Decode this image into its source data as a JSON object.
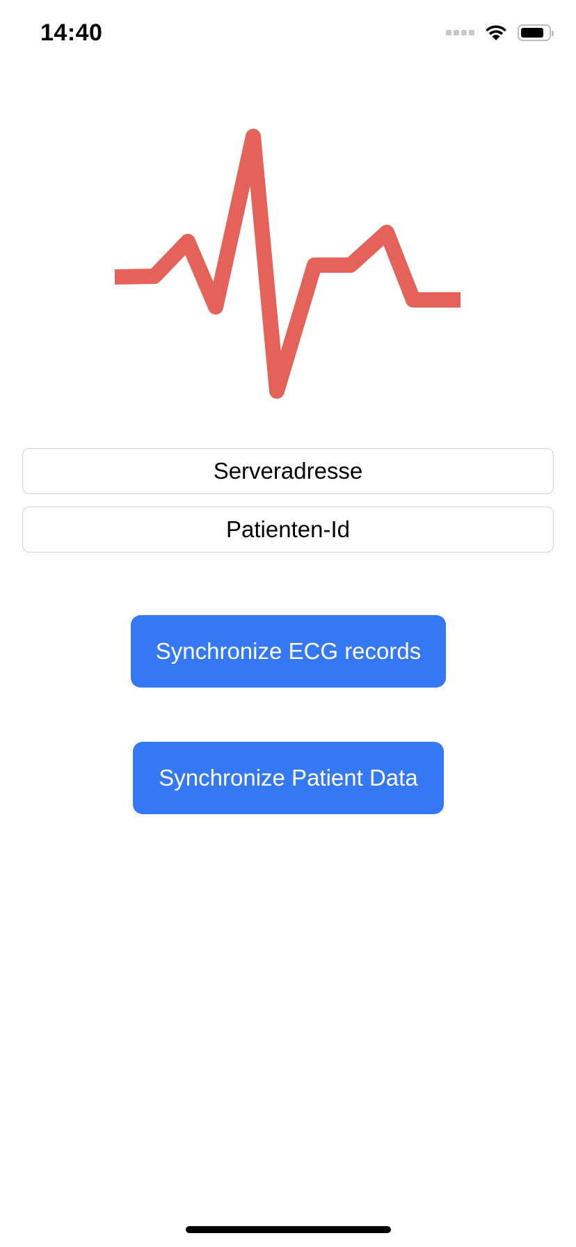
{
  "status_bar": {
    "time": "14:40",
    "icons": [
      "signal-icon",
      "wifi-icon",
      "battery-icon"
    ]
  },
  "logo": {
    "icon": "heartbeat-icon",
    "color": "#e5625a"
  },
  "form": {
    "server_placeholder": "Serveradresse",
    "server_value": "",
    "patient_placeholder": "Patienten-Id",
    "patient_value": ""
  },
  "actions": {
    "sync_ecg_label": "Synchronize ECG records",
    "sync_patient_label": "Synchronize Patient Data",
    "button_color": "#3478f6"
  }
}
